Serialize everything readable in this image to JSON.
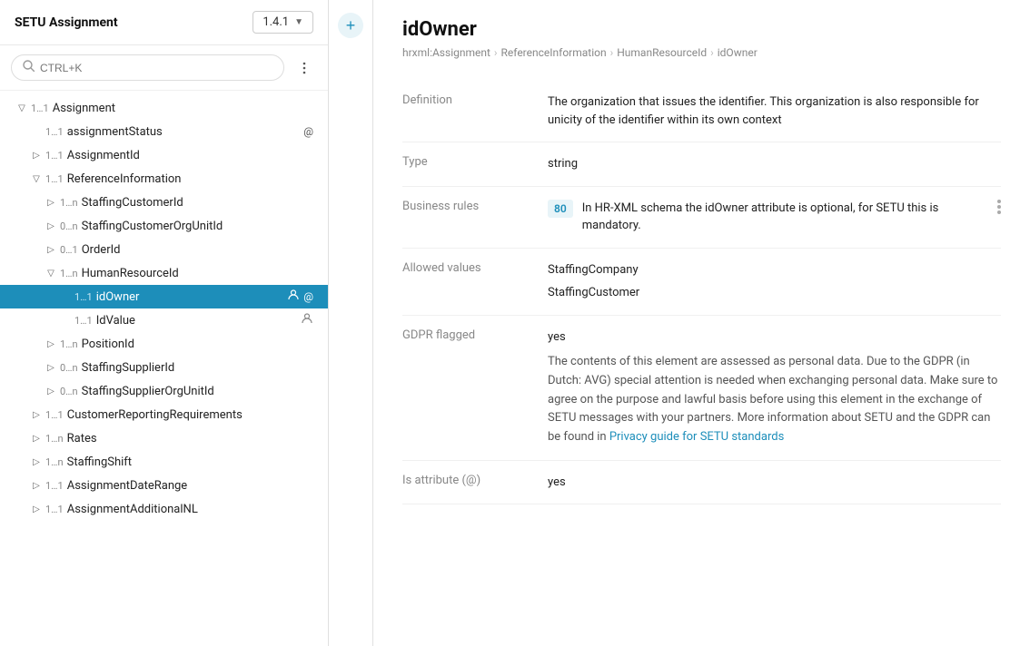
{
  "leftPanel": {
    "title": "SETU Assignment",
    "version": "1.4.1",
    "search": {
      "placeholder": "CTRL+K",
      "shortcut": "CTRL+K"
    },
    "tree": [
      {
        "id": "assignment",
        "label": "Assignment",
        "meta": "1…1",
        "indent": 1,
        "type": "root",
        "expanded": true
      },
      {
        "id": "assignmentStatus",
        "label": "assignmentStatus",
        "meta": "1…1",
        "indent": 2,
        "type": "leaf",
        "icons": [
          "at"
        ]
      },
      {
        "id": "assignmentId",
        "label": "AssignmentId",
        "meta": "1…1",
        "indent": 2,
        "type": "collapsed"
      },
      {
        "id": "referenceInformation",
        "label": "ReferenceInformation",
        "meta": "1…1",
        "indent": 2,
        "type": "expanded"
      },
      {
        "id": "staffingCustomerId",
        "label": "StaffingCustomerId",
        "meta": "1…n",
        "indent": 3,
        "type": "collapsed"
      },
      {
        "id": "staffingCustomerOrgUnitId",
        "label": "StaffingCustomerOrgUnitId",
        "meta": "0…n",
        "indent": 3,
        "type": "collapsed"
      },
      {
        "id": "orderId",
        "label": "OrderId",
        "meta": "0…1",
        "indent": 3,
        "type": "collapsed"
      },
      {
        "id": "humanResourceId",
        "label": "HumanResourceId",
        "meta": "1…n",
        "indent": 3,
        "type": "expanded"
      },
      {
        "id": "idOwner",
        "label": "idOwner",
        "meta": "1…1",
        "indent": 4,
        "type": "leaf",
        "selected": true,
        "icons": [
          "person",
          "at"
        ]
      },
      {
        "id": "idValue",
        "label": "IdValue",
        "meta": "1…1",
        "indent": 4,
        "type": "leaf",
        "icons": [
          "person"
        ]
      },
      {
        "id": "positionId",
        "label": "PositionId",
        "meta": "1…n",
        "indent": 3,
        "type": "collapsed"
      },
      {
        "id": "staffingSupplierId",
        "label": "StaffingSupplierId",
        "meta": "0…n",
        "indent": 3,
        "type": "collapsed"
      },
      {
        "id": "staffingSupplierOrgUnitId",
        "label": "StaffingSupplierOrgUnitId",
        "meta": "0…n",
        "indent": 3,
        "type": "collapsed"
      },
      {
        "id": "customerReportingRequirements",
        "label": "CustomerReportingRequirements",
        "meta": "1…1",
        "indent": 2,
        "type": "collapsed"
      },
      {
        "id": "rates",
        "label": "Rates",
        "meta": "1…n",
        "indent": 2,
        "type": "collapsed"
      },
      {
        "id": "staffingShift",
        "label": "StaffingShift",
        "meta": "1…n",
        "indent": 2,
        "type": "collapsed"
      },
      {
        "id": "assignmentDateRange",
        "label": "AssignmentDateRange",
        "meta": "1…1",
        "indent": 2,
        "type": "collapsed"
      },
      {
        "id": "assignmentAdditionalNL",
        "label": "AssignmentAdditionalNL",
        "meta": "1…1",
        "indent": 2,
        "type": "collapsed"
      }
    ]
  },
  "addButton": "+",
  "rightPanel": {
    "title": "idOwner",
    "breadcrumb": [
      "hrxml:Assignment",
      "ReferenceInformation",
      "HumanResourceId",
      "idOwner"
    ],
    "fields": {
      "definition": {
        "label": "Definition",
        "value": "The organization that issues the identifier. This organization is also responsible for unicity of the identifier within its own context"
      },
      "type": {
        "label": "Type",
        "value": "string"
      },
      "businessRules": {
        "label": "Business rules",
        "badgeNumber": "80",
        "text": "In HR-XML schema the idOwner attribute is optional, for SETU this is mandatory."
      },
      "allowedValues": {
        "label": "Allowed values",
        "values": [
          "StaffingCompany",
          "StaffingCustomer"
        ]
      },
      "gdpr": {
        "label": "GDPR flagged",
        "flagged": "yes",
        "description": "The contents of this element are assessed as personal data. Due to the GDPR (in Dutch: AVG) special attention is needed when exchanging personal data. Make sure to agree on the purpose and lawful basis before using this element in the exchange of SETU messages with your partners. More information about SETU and the GDPR can be found in",
        "linkText": "Privacy guide for SETU standards",
        "linkEnd": ""
      },
      "isAttribute": {
        "label": "Is attribute (@)",
        "value": "yes"
      }
    }
  }
}
